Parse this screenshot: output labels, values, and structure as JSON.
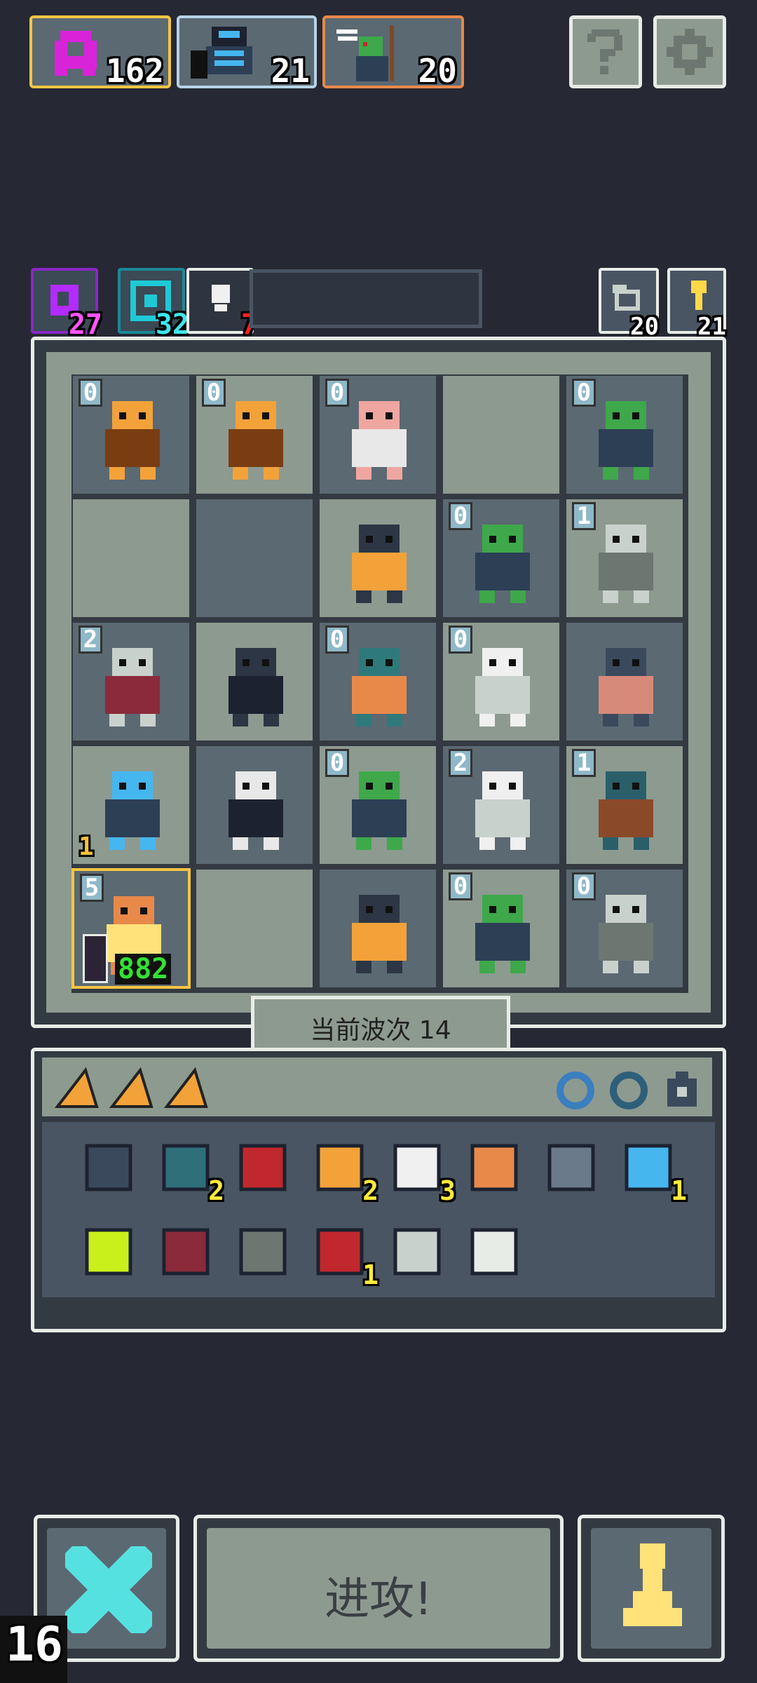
{
  "top_bar": {
    "cards": [
      {
        "name": "magenta-ghost",
        "count": "162",
        "border": "#f5c542"
      },
      {
        "name": "blue-knight",
        "count": "21",
        "border": "#b7d3e6"
      },
      {
        "name": "goblin-archer",
        "count": "20",
        "border": "#e8894a"
      }
    ],
    "help_icon": "question-mark-icon",
    "settings_icon": "gear-icon"
  },
  "status_row": {
    "cards": [
      {
        "count": "27",
        "color": "#b22cff"
      },
      {
        "count": "32",
        "color": "#1ec9d6"
      },
      {
        "count": "7",
        "color": "#e8ece6"
      }
    ],
    "right_cards": [
      {
        "count": "20",
        "icon": "return-arrow-icon"
      },
      {
        "count": "21",
        "icon": "key-icon"
      }
    ]
  },
  "board": {
    "rows": [
      [
        {
          "lvl": "0",
          "unit": "orange-demon"
        },
        {
          "lvl": "0",
          "unit": "orange-demon"
        },
        {
          "lvl": "0",
          "unit": "pink-mushroom"
        },
        {
          "lvl": "",
          "unit": ""
        },
        {
          "lvl": "0",
          "unit": "goblin-archer"
        }
      ],
      [
        {
          "lvl": "",
          "unit": ""
        },
        {
          "lvl": "",
          "unit": ""
        },
        {
          "lvl": "",
          "unit": "crow"
        },
        {
          "lvl": "0",
          "unit": "goblin-archer"
        },
        {
          "lvl": "1",
          "unit": "gargoyle"
        }
      ],
      [
        {
          "lvl": "2",
          "unit": "skull-lich"
        },
        {
          "lvl": "",
          "unit": "hat-man"
        },
        {
          "lvl": "0",
          "unit": "eye-beast"
        },
        {
          "lvl": "0",
          "unit": "white-ghost"
        },
        {
          "lvl": "",
          "unit": "hooded-thief"
        }
      ],
      [
        {
          "lvl": "",
          "unit": "blue-knight",
          "sub": "1"
        },
        {
          "lvl": "",
          "unit": "white-hair-ghost"
        },
        {
          "lvl": "0",
          "unit": "goblin-archer"
        },
        {
          "lvl": "2",
          "unit": "white-ghost"
        },
        {
          "lvl": "1",
          "unit": "tree"
        }
      ],
      [
        {
          "lvl": "5",
          "unit": "hero-dwarf",
          "hp": "882"
        },
        {
          "lvl": "",
          "unit": ""
        },
        {
          "lvl": "",
          "unit": "crow"
        },
        {
          "lvl": "0",
          "unit": "goblin-archer"
        },
        {
          "lvl": "0",
          "unit": "gargoyle"
        }
      ]
    ]
  },
  "wave_label": "当前波次 14",
  "inventory": {
    "row1": [
      {
        "icon": "shield-icon",
        "count": ""
      },
      {
        "icon": "gem-heart-icon",
        "count": "2"
      },
      {
        "icon": "red-flower-icon",
        "count": ""
      },
      {
        "icon": "trophy-icon",
        "count": "2"
      },
      {
        "icon": "white-egg-icon",
        "count": "3"
      },
      {
        "icon": "dagger-icon",
        "count": ""
      },
      {
        "icon": "stone-icon",
        "count": ""
      },
      {
        "icon": "blue-orb-icon",
        "count": "1"
      }
    ],
    "row2": [
      {
        "icon": "potion-icon",
        "count": ""
      },
      {
        "icon": "bomb-icon",
        "count": ""
      },
      {
        "icon": "armor-icon",
        "count": ""
      },
      {
        "icon": "mouth-icon",
        "count": "1"
      },
      {
        "icon": "chest-icon",
        "count": ""
      },
      {
        "icon": "knife-icon",
        "count": ""
      }
    ]
  },
  "bottom": {
    "cancel_icon": "x-icon",
    "attack_label": "进攻!",
    "pawn_icon": "pawn-icon",
    "corner_number": "16"
  },
  "colors": {
    "background": "#262833",
    "panel": "#8d9a90",
    "cell_dark": "#5b6973",
    "accent_cyan": "#56e1e1",
    "accent_yellow": "#ffe27a",
    "hp_green": "#33e133"
  }
}
